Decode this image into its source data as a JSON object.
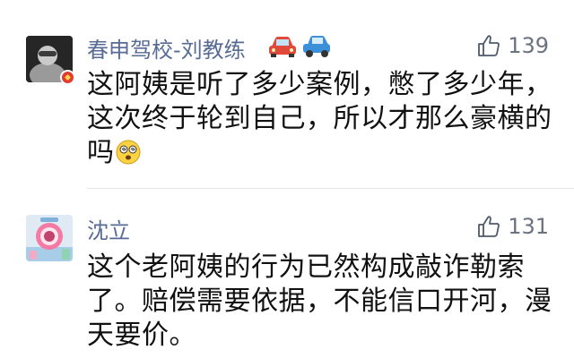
{
  "comments": [
    {
      "username": "春申驾校-刘教练",
      "name_emojis": [
        "red-car-emoji",
        "blue-car-emoji"
      ],
      "like_count": "139",
      "text_lines": [
        "这阿姨是听了多少案例，憋了多少年，",
        "这次终于轮到自己，所以才那么豪横的",
        "吗"
      ],
      "text_emoji": "dizzy-face-emoji"
    },
    {
      "username": "沈立",
      "like_count": "131",
      "text_lines": [
        "这个老阿姨的行为已然构成敲诈勒索",
        "了。赔偿需要依据，不能信口开河，漫",
        "天要价。"
      ]
    }
  ]
}
